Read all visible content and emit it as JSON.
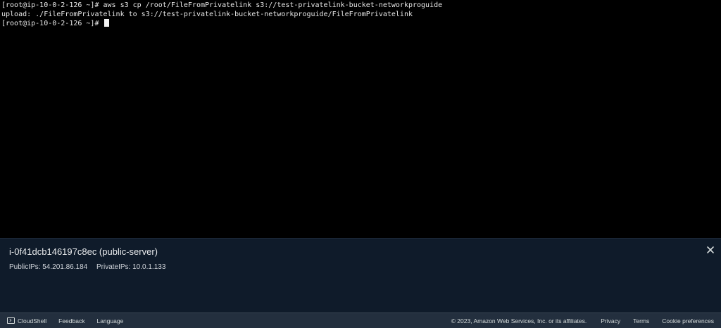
{
  "terminal": {
    "lines": [
      "[root@ip-10-0-2-126 ~]# aws s3 cp /root/FileFromPrivatelink s3://test-privatelink-bucket-networkproguide",
      "upload: ./FileFromPrivatelink to s3://test-privatelink-bucket-networkproguide/FileFromPrivatelink",
      "[root@ip-10-0-2-126 ~]# "
    ],
    "colors": {
      "background": "#000000",
      "text": "#e8e8e8"
    }
  },
  "instance_panel": {
    "title": "i-0f41dcb146197c8ec (public-server)",
    "public_ips": "PublicIPs: 54.201.86.184",
    "private_ips": "PrivateIPs: 10.0.1.133",
    "close_icon": "close-icon",
    "colors": {
      "background": "#0f1b2a"
    }
  },
  "footer": {
    "cloudshell_label": "CloudShell",
    "cloudshell_icon": "terminal-icon",
    "feedback_label": "Feedback",
    "language_label": "Language",
    "copyright": "© 2023, Amazon Web Services, Inc. or its affiliates.",
    "privacy_label": "Privacy",
    "terms_label": "Terms",
    "cookie_label": "Cookie preferences",
    "colors": {
      "background": "#232f3e",
      "text": "#d5dbdb"
    }
  }
}
